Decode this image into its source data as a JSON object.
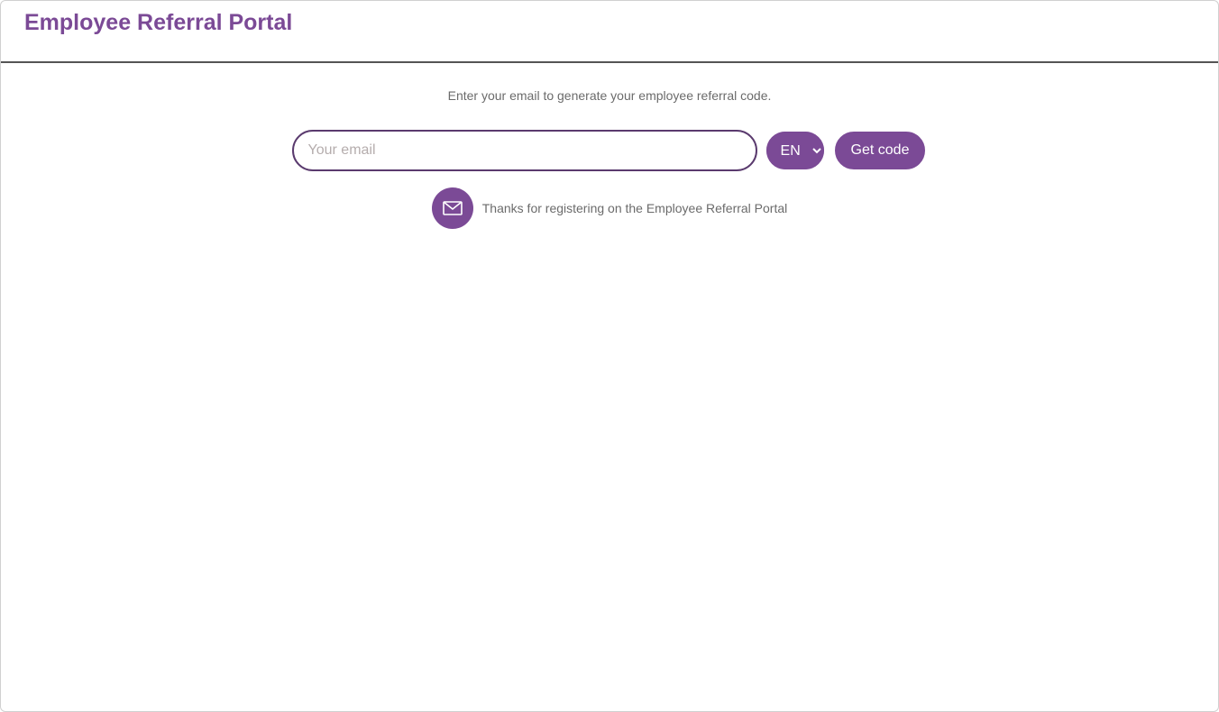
{
  "header": {
    "title": "Employee Referral Portal"
  },
  "main": {
    "prompt": "Enter your email to generate your employee referral code.",
    "email_placeholder": "Your email",
    "email_value": "",
    "lang_selected": "EN",
    "lang_options": [
      "EN"
    ],
    "get_code_label": "Get code",
    "status_message": "Thanks for registering on the Employee Referral Portal"
  },
  "colors": {
    "accent": "#7b4a96",
    "text_muted": "#6b6b6b"
  },
  "icons": {
    "mail": "mail-icon"
  }
}
